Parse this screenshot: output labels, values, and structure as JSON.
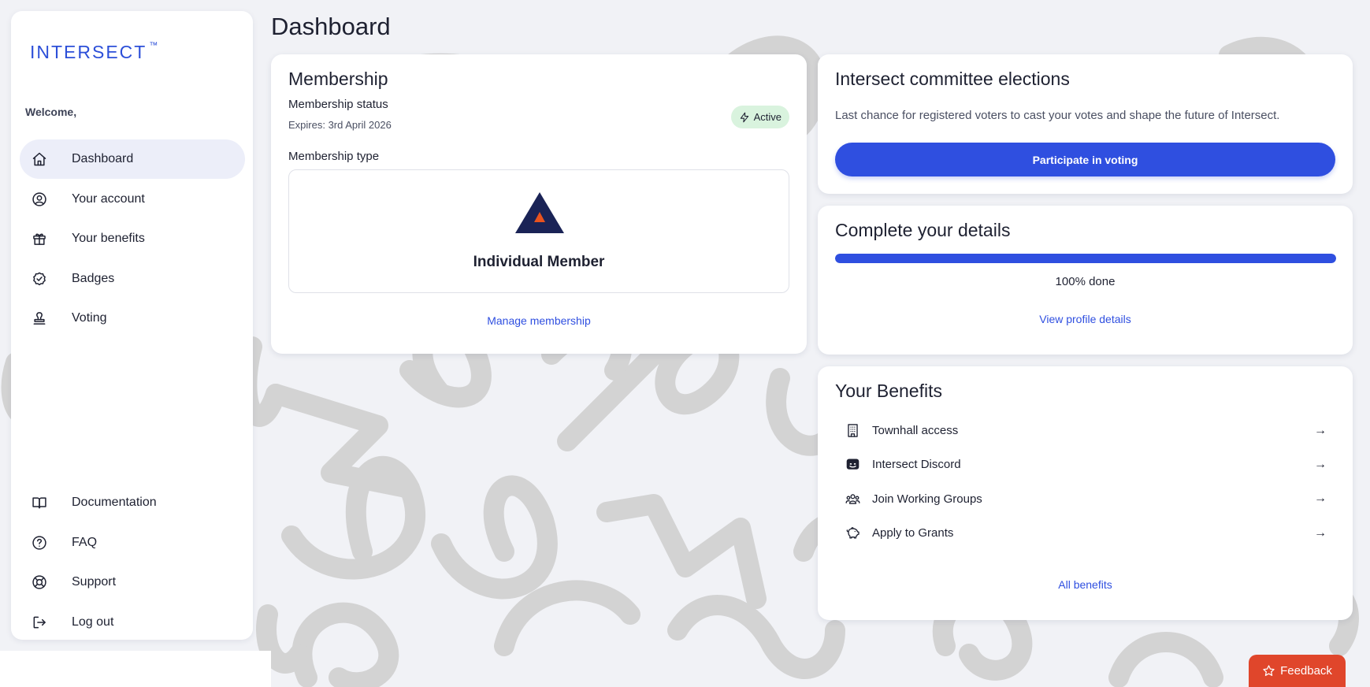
{
  "app": {
    "logo_text": "INTERSECT",
    "logo_tm": "™",
    "welcome": "Welcome,"
  },
  "sidebar": {
    "items": [
      {
        "label": "Dashboard",
        "icon": "home-icon",
        "active": true
      },
      {
        "label": "Your account",
        "icon": "user-circle-icon"
      },
      {
        "label": "Your benefits",
        "icon": "gift-icon"
      },
      {
        "label": "Badges",
        "icon": "badge-check-icon"
      },
      {
        "label": "Voting",
        "icon": "vote-stamp-icon"
      }
    ],
    "bottom_items": [
      {
        "label": "Documentation",
        "icon": "book-open-icon"
      },
      {
        "label": "FAQ",
        "icon": "help-circle-icon"
      },
      {
        "label": "Support",
        "icon": "life-buoy-icon"
      },
      {
        "label": "Log out",
        "icon": "log-out-icon"
      }
    ]
  },
  "header": {
    "title": "Dashboard"
  },
  "membership": {
    "title": "Membership",
    "status_label": "Membership status",
    "expires": "Expires: 3rd April 2026",
    "status_badge": "Active",
    "type_label": "Membership type",
    "type_name": "Individual Member",
    "manage_link": "Manage membership",
    "colors": {
      "logo_navy": "#1a2356",
      "logo_orange": "#e8531f",
      "badge_bg": "#d9f3de"
    }
  },
  "elections": {
    "title": "Intersect committee elections",
    "description": "Last chance for registered voters to cast your votes and shape the future of Intersect.",
    "button": "Participate in voting"
  },
  "details": {
    "title": "Complete your details",
    "progress": 100,
    "progress_text": "100% done",
    "link": "View profile details"
  },
  "benefits": {
    "title": "Your Benefits",
    "items": [
      {
        "label": "Townhall access",
        "icon": "building-icon"
      },
      {
        "label": "Intersect Discord",
        "icon": "discord-icon"
      },
      {
        "label": "Join Working Groups",
        "icon": "users-group-icon"
      },
      {
        "label": "Apply to Grants",
        "icon": "piggy-bank-icon"
      }
    ],
    "arrow": "→",
    "all_link": "All benefits"
  },
  "feedback": {
    "label": "Feedback",
    "icon": "star-icon"
  },
  "colors": {
    "accent": "#2f4fe0",
    "feedback": "#e0462b",
    "background": "#f1f2f6"
  }
}
